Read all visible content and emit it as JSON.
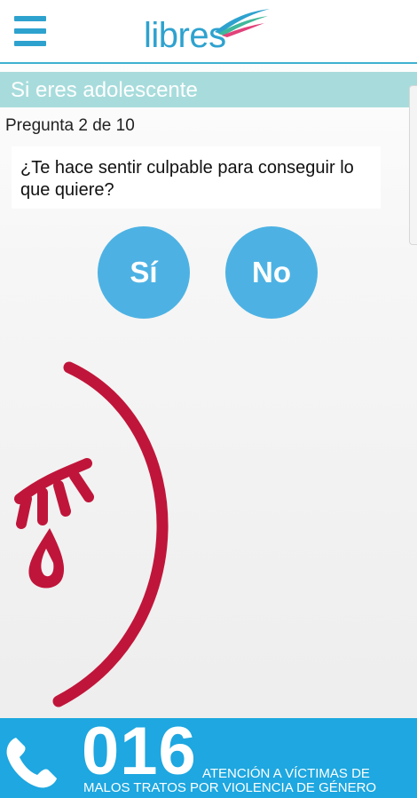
{
  "header": {
    "logo_text": "libres",
    "menu_icon": "hamburger-menu-icon"
  },
  "section": {
    "title": "Si eres adolescente"
  },
  "question": {
    "counter": "Pregunta 2 de 10",
    "text": "¿Te hace sentir culpable para conseguir lo que quiere?"
  },
  "answers": {
    "yes_label": "Sí",
    "no_label": "No"
  },
  "illustration": {
    "name": "crying-face",
    "color": "#c0153a"
  },
  "footer": {
    "number": "016",
    "line1": "ATENCIÓN A VÍCTIMAS DE",
    "line2": "MALOS TRATOS POR VIOLENCIA DE GÉNERO",
    "icon": "phone-icon"
  },
  "colors": {
    "accent": "#2ea2cf",
    "section_bar": "#a8dcdc",
    "button": "#4db2e3",
    "footer": "#1ea7e0",
    "illustration": "#c0153a"
  }
}
